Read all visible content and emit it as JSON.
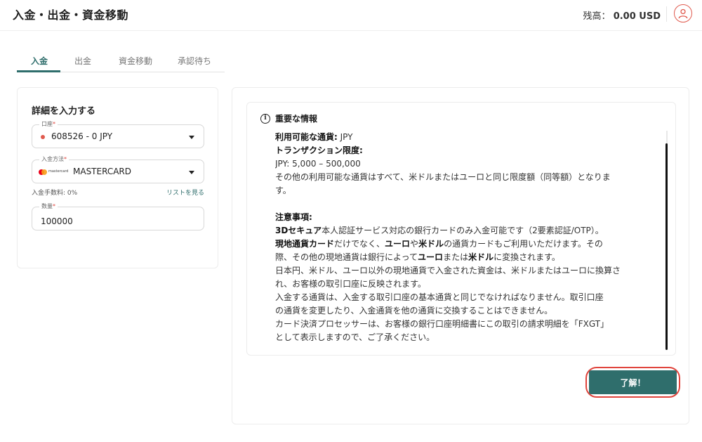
{
  "header": {
    "title": "入金・出金・資金移動",
    "balance_label": "残高：",
    "balance_int": "0.",
    "balance_dec": "00 USD",
    "user_icon": "user-circle-icon",
    "accent_color": "#e05a4e"
  },
  "tabs": [
    {
      "label": "入金",
      "active": true
    },
    {
      "label": "出金",
      "active": false
    },
    {
      "label": "資金移動",
      "active": false
    },
    {
      "label": "承認待ち",
      "active": false
    }
  ],
  "form": {
    "section_title": "詳細を入力する",
    "account": {
      "label": "口座",
      "required_mark": "*",
      "value": "608526 - 0 JPY"
    },
    "method": {
      "label": "入金方法",
      "required_mark": "*",
      "logo_text": "mastercard",
      "value": "MASTERCARD"
    },
    "fee": {
      "text": "入金手数料: 0%",
      "link": "リストを見る"
    },
    "amount": {
      "label": "数量",
      "required_mark": "*",
      "value": "100000"
    }
  },
  "info": {
    "title": "重要な情報",
    "currencies_label": "利用可能な通貨:",
    "currencies_value": " JPY",
    "limit_label": "トランザクション限度:",
    "limit_value": "JPY: 5,000 – 500,000",
    "limit_note": "その他の利用可能な通貨はすべて、米ドルまたはユーロと同じ限度額（同等額）となりま",
    "limit_note2": "す。",
    "notes_label": "注意事項:",
    "n1_bold": "3Dセキュア",
    "n1_rest": "本人認証サービス対応の銀行カードのみ入金可能です（2要素認証/OTP）。",
    "n2_b1": "現地通貨カード",
    "n2_t1": "だけでなく、",
    "n2_b2": "ユーロ",
    "n2_t2": "や",
    "n2_b3": "米ドル",
    "n2_t3": "の通貨カードもご利用いただけます。その",
    "n3_t1": "際、その他の現地通貨は銀行によって",
    "n3_b1": "ユーロ",
    "n3_t2": "または",
    "n3_b2": "米ドル",
    "n3_t3": "に変換されます。",
    "n4": "日本円、米ドル、ユーロ以外の現地通貨で入金された資金は、米ドルまたはユーロに換算さ",
    "n5": "れ、お客様の取引口座に反映されます。",
    "n6": "入金する通貨は、入金する取引口座の基本通貨と同じでなければなりません。取引口座",
    "n7": "の通貨を変更したり、入金通貨を他の通貨に交換することはできません。",
    "n8": "カード決済プロセッサーは、お客様の銀行口座明細書にこの取引の請求明細を「FXGT」",
    "n9": "として表示しますので、ご了承ください。"
  },
  "confirm_button": "了解！",
  "colors": {
    "primary": "#2f6e6c",
    "highlight": "#e0443c"
  }
}
